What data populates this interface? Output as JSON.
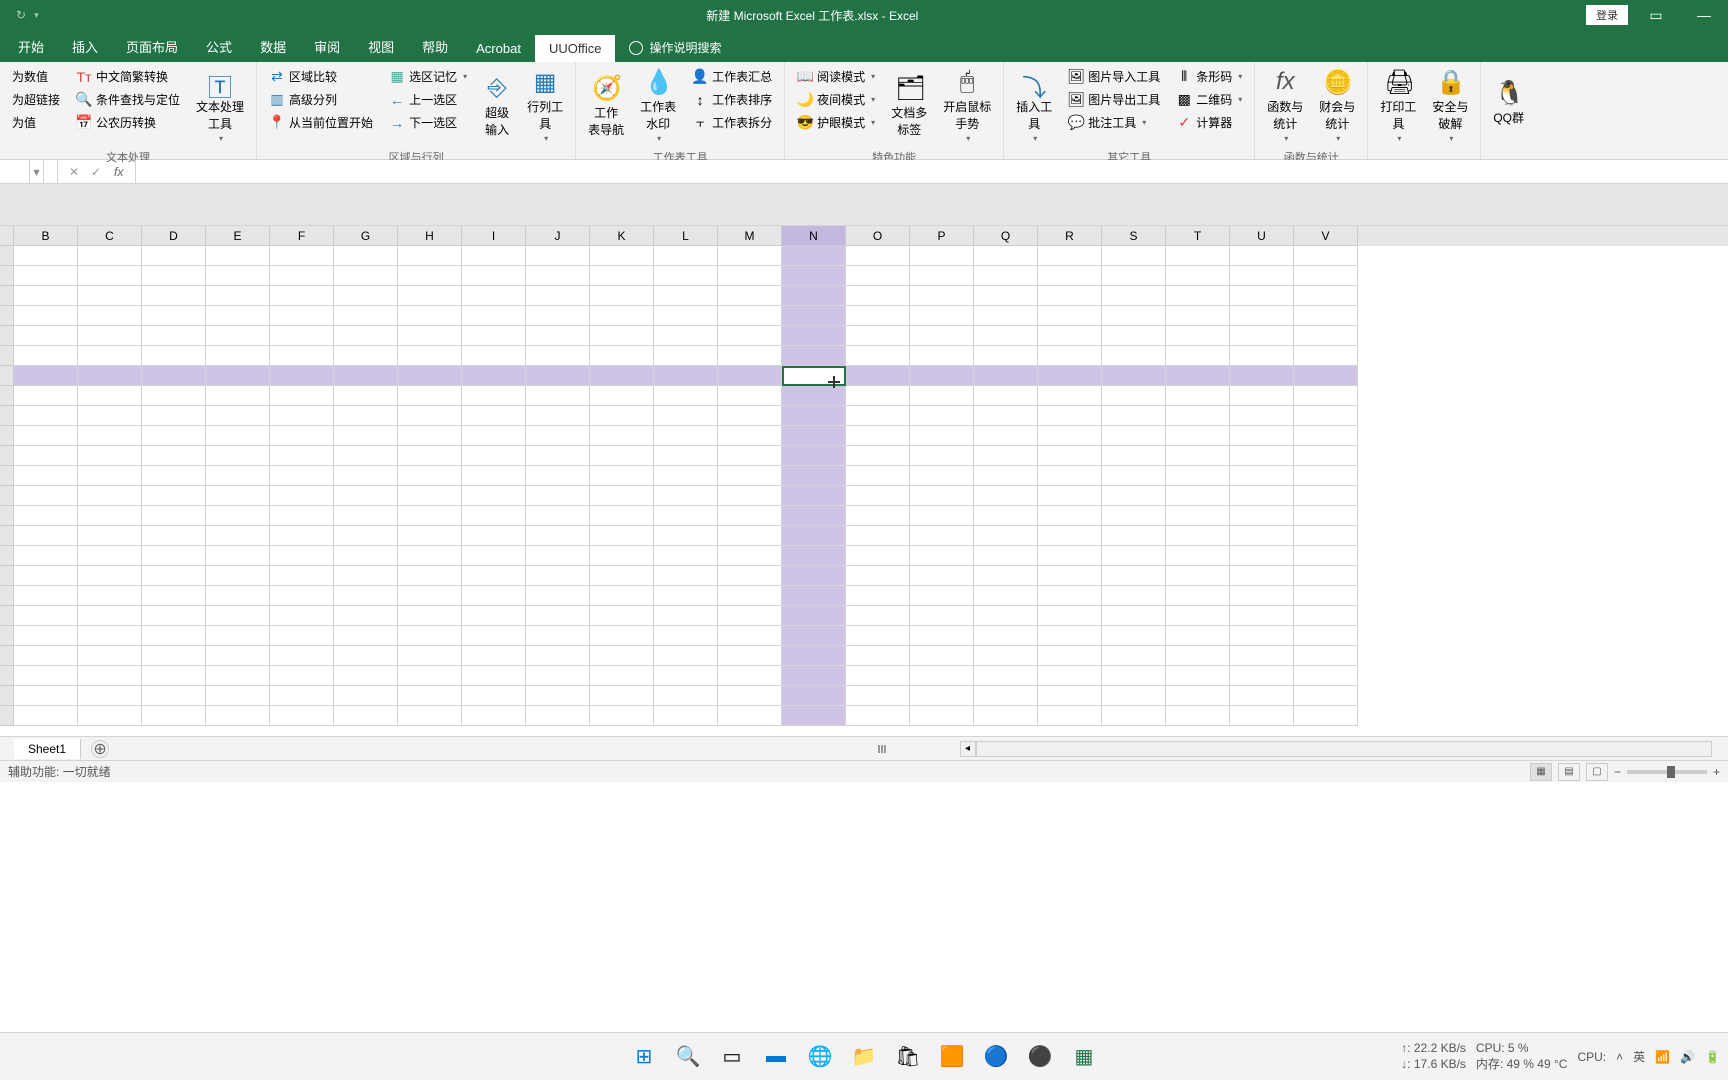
{
  "titlebar": {
    "title": "新建 Microsoft Excel 工作表.xlsx  -  Excel",
    "login": "登录"
  },
  "tabs": [
    "开始",
    "插入",
    "页面布局",
    "公式",
    "数据",
    "审阅",
    "视图",
    "帮助",
    "Acrobat",
    "UUOffice"
  ],
  "active_tab": 9,
  "tab_search": "操作说明搜索",
  "ribbon": {
    "g1": {
      "label": "文本处理",
      "items": [
        "为数值",
        "为超链接",
        "为值",
        "中文简繁转换",
        "条件查找与定位",
        "公农历转换"
      ],
      "big": "文本处理\n工具"
    },
    "g2": {
      "label": "区域与行列",
      "items": [
        "区域比较",
        "高级分列",
        "从当前位置开始",
        "选区记忆",
        "上一选区",
        "下一选区"
      ],
      "bigs": [
        "超级\n输入",
        "行列工\n具"
      ]
    },
    "g3": {
      "label": "工作表工具",
      "bigs": [
        "工作\n表导航",
        "工作表\n水印"
      ],
      "items": [
        "工作表汇总",
        "工作表排序",
        "工作表拆分"
      ]
    },
    "g4": {
      "label": "特色功能",
      "items": [
        "阅读模式",
        "夜间模式",
        "护眼模式"
      ],
      "bigs": [
        "文档多\n标签",
        "开启鼠标\n手势"
      ]
    },
    "g5": {
      "label": "其它工具",
      "big": "插入工\n具",
      "items": [
        "图片导入工具",
        "图片导出工具",
        "批注工具",
        "条形码",
        "二维码",
        "计算器"
      ]
    },
    "g6": {
      "label": "函数与统计",
      "bigs": [
        "函数与\n统计",
        "财会与\n统计"
      ]
    },
    "g7": {
      "bigs": [
        "打印工\n具",
        "安全与\n破解"
      ]
    },
    "g8": {
      "big": "QQ群"
    }
  },
  "formula": {
    "fx": "fx"
  },
  "columns": [
    "B",
    "C",
    "D",
    "E",
    "F",
    "G",
    "H",
    "I",
    "J",
    "K",
    "L",
    "M",
    "N",
    "O",
    "P",
    "Q",
    "R",
    "S",
    "T",
    "U",
    "V"
  ],
  "selected_col": 12,
  "selected_row": 6,
  "num_rows": 24,
  "sheet": {
    "name": "Sheet1",
    "status": "辅助功能: 一切就绪"
  },
  "taskbar_stats": {
    "net_up": "↑: 22.2 KB/s",
    "net_down": "↓: 17.6 KB/s",
    "cpu": "CPU: 5 %",
    "cpu2": "CPU:",
    "mem": "内存: 49 % 49 °C",
    "ime": "英"
  }
}
